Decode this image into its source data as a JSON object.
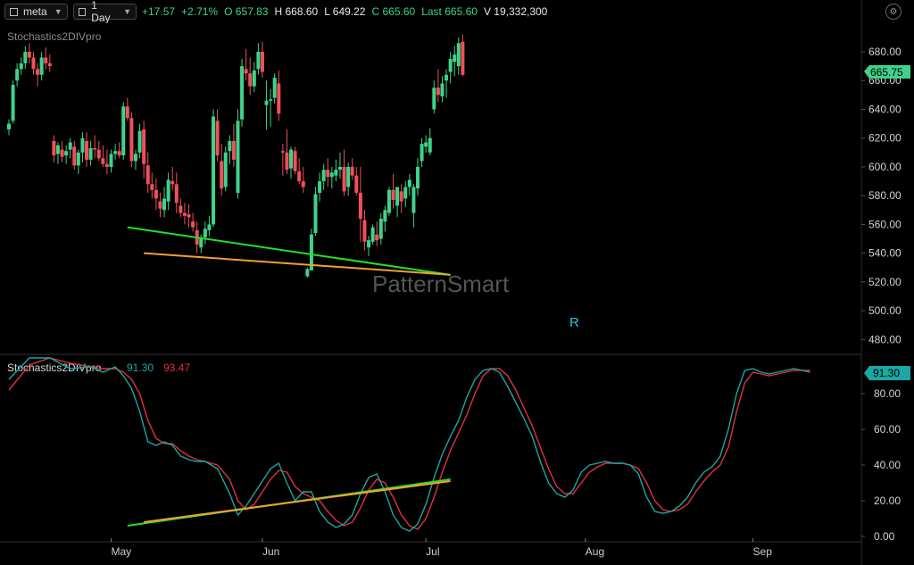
{
  "toolbar": {
    "symbol": "meta",
    "interval": "1 Day",
    "change": "+17.57",
    "change_pct": "+2.71%",
    "open_label": "O",
    "open": "657.83",
    "high_label": "H",
    "high": "668.60",
    "low_label": "L",
    "low": "649.22",
    "close_label": "C",
    "close": "665.60",
    "last_label": "Last",
    "last": "665.60",
    "volume_label": "V",
    "volume": "19,332,300"
  },
  "colors": {
    "up": "#3fd28a",
    "down": "#f0505a",
    "k_line": "#1ba7a4",
    "d_line": "#e0303f",
    "div_green": "#22e02a",
    "div_orange": "#f0a030"
  },
  "chart_data": [
    {
      "type": "candlestick",
      "indicator_name": "Stochastics2DIVpro",
      "watermark": "PatternSmart",
      "annotation": "R",
      "price_badge": "665.75",
      "ylim": [
        470,
        690
      ],
      "yticks": [
        "680.00",
        "660.00",
        "640.00",
        "620.00",
        "600.00",
        "580.00",
        "560.00",
        "540.00",
        "520.00",
        "500.00",
        "480.00"
      ],
      "x_labels": [
        "May",
        "Jun",
        "Jul",
        "Aug",
        "Sep"
      ],
      "candles": [
        [
          626,
          633,
          622,
          630
        ],
        [
          632,
          660,
          630,
          657
        ],
        [
          660,
          672,
          656,
          668
        ],
        [
          668,
          676,
          664,
          672
        ],
        [
          672,
          684,
          668,
          680
        ],
        [
          680,
          686,
          672,
          676
        ],
        [
          676,
          680,
          664,
          668
        ],
        [
          668,
          672,
          656,
          664
        ],
        [
          664,
          680,
          660,
          676
        ],
        [
          676,
          683,
          668,
          672
        ],
        [
          672,
          678,
          666,
          670
        ],
        [
          618,
          622,
          603,
          608
        ],
        [
          609,
          617,
          602,
          615
        ],
        [
          612,
          618,
          603,
          607
        ],
        [
          608,
          615,
          602,
          611
        ],
        [
          612,
          620,
          606,
          617
        ],
        [
          614,
          618,
          598,
          601
        ],
        [
          601,
          612,
          595,
          610
        ],
        [
          610,
          624,
          603,
          620
        ],
        [
          618,
          624,
          600,
          605
        ],
        [
          605,
          618,
          601,
          613
        ],
        [
          613,
          622,
          606,
          612
        ],
        [
          612,
          618,
          604,
          606
        ],
        [
          606,
          615,
          600,
          602
        ],
        [
          602,
          612,
          595,
          600
        ],
        [
          600,
          612,
          596,
          609
        ],
        [
          609,
          616,
          605,
          611
        ],
        [
          611,
          617,
          606,
          608
        ],
        [
          608,
          645,
          605,
          642
        ],
        [
          642,
          648,
          632,
          634
        ],
        [
          634,
          638,
          600,
          604
        ],
        [
          604,
          612,
          598,
          609
        ],
        [
          610,
          630,
          606,
          625
        ],
        [
          626,
          632,
          592,
          602
        ],
        [
          601,
          610,
          582,
          588
        ],
        [
          588,
          596,
          578,
          584
        ],
        [
          584,
          592,
          570,
          578
        ],
        [
          576,
          582,
          565,
          571
        ],
        [
          570,
          586,
          565,
          578
        ],
        [
          576,
          596,
          570,
          591
        ],
        [
          590,
          600,
          584,
          588
        ],
        [
          588,
          596,
          568,
          575
        ],
        [
          573,
          578,
          565,
          568
        ],
        [
          568,
          575,
          560,
          566
        ],
        [
          567,
          574,
          558,
          565
        ],
        [
          562,
          568,
          555,
          558
        ],
        [
          556,
          562,
          540,
          546
        ],
        [
          544,
          553,
          540,
          551
        ],
        [
          551,
          562,
          546,
          557
        ],
        [
          556,
          566,
          552,
          560
        ],
        [
          560,
          640,
          558,
          635
        ],
        [
          632,
          640,
          604,
          608
        ],
        [
          604,
          616,
          580,
          585
        ],
        [
          586,
          614,
          583,
          610
        ],
        [
          611,
          622,
          602,
          618
        ],
        [
          618,
          630,
          600,
          605
        ],
        [
          582,
          640,
          578,
          632
        ],
        [
          633,
          675,
          628,
          670
        ],
        [
          668,
          682,
          660,
          665
        ],
        [
          665,
          676,
          650,
          656
        ],
        [
          656,
          673,
          652,
          667
        ],
        [
          668,
          686,
          664,
          680
        ],
        [
          680,
          687,
          662,
          666
        ],
        [
          643,
          660,
          626,
          646
        ],
        [
          646,
          654,
          628,
          647
        ],
        [
          648,
          665,
          644,
          662
        ],
        [
          658,
          667,
          632,
          637
        ],
        [
          611,
          616,
          594,
          610
        ],
        [
          610,
          626,
          595,
          598
        ],
        [
          599,
          614,
          592,
          612
        ],
        [
          611,
          614,
          595,
          597
        ],
        [
          597,
          606,
          588,
          590
        ],
        [
          590,
          600,
          582,
          586
        ],
        [
          524,
          530,
          523,
          529
        ],
        [
          528,
          557,
          528,
          553
        ],
        [
          554,
          586,
          552,
          581
        ],
        [
          582,
          596,
          576,
          590
        ],
        [
          590,
          602,
          584,
          598
        ],
        [
          598,
          606,
          586,
          593
        ],
        [
          593,
          600,
          585,
          596
        ],
        [
          594,
          605,
          590,
          598
        ],
        [
          598,
          610,
          592,
          600
        ],
        [
          600,
          612,
          580,
          583
        ],
        [
          586,
          603,
          580,
          600
        ],
        [
          600,
          606,
          591,
          594
        ],
        [
          594,
          600,
          580,
          582
        ],
        [
          582,
          600,
          548,
          564
        ],
        [
          563,
          570,
          542,
          548
        ],
        [
          544,
          552,
          538,
          549
        ],
        [
          548,
          560,
          546,
          558
        ],
        [
          553,
          562,
          545,
          549
        ],
        [
          550,
          568,
          546,
          564
        ],
        [
          562,
          573,
          555,
          570
        ],
        [
          568,
          586,
          566,
          584
        ],
        [
          584,
          595,
          571,
          577
        ],
        [
          573,
          586,
          565,
          586
        ],
        [
          583,
          588,
          568,
          576
        ],
        [
          578,
          590,
          572,
          586
        ],
        [
          586,
          595,
          580,
          591
        ],
        [
          568,
          588,
          558,
          586
        ],
        [
          585,
          606,
          580,
          600
        ],
        [
          604,
          620,
          600,
          616
        ],
        [
          614,
          622,
          610,
          617
        ],
        [
          610,
          627,
          608,
          620
        ],
        [
          640,
          660,
          637,
          655
        ],
        [
          655,
          668,
          645,
          650
        ],
        [
          649,
          663,
          645,
          658
        ],
        [
          660,
          668,
          648,
          664
        ],
        [
          666,
          680,
          658,
          675
        ],
        [
          673,
          684,
          663,
          678
        ],
        [
          670,
          690,
          664,
          686
        ],
        [
          687,
          692,
          663,
          664
        ]
      ],
      "price_divergence": {
        "green": [
          [
            29,
            558
          ],
          [
            108,
            525
          ]
        ],
        "orange": [
          [
            33,
            540
          ],
          [
            108,
            525
          ]
        ]
      }
    },
    {
      "type": "line",
      "name": "Stochastics2DIVpro",
      "k_value": "91.30",
      "d_value": "93.47",
      "price_badge": "91.30",
      "ylim": [
        0,
        100
      ],
      "yticks": [
        "80.00",
        "60.00",
        "40.00",
        "20.00",
        "0.00"
      ],
      "k_points": [
        [
          0,
          88
        ],
        [
          5,
          100
        ],
        [
          10,
          100
        ],
        [
          15,
          94
        ],
        [
          20,
          95
        ],
        [
          23,
          92
        ],
        [
          26,
          95
        ],
        [
          28,
          90
        ],
        [
          30,
          83
        ],
        [
          32,
          70
        ],
        [
          34,
          53
        ],
        [
          36,
          51
        ],
        [
          38,
          53
        ],
        [
          40,
          51
        ],
        [
          42,
          45
        ],
        [
          44,
          43
        ],
        [
          46,
          42
        ],
        [
          48,
          42
        ],
        [
          51,
          38
        ],
        [
          54,
          24
        ],
        [
          56,
          12
        ],
        [
          58,
          17
        ],
        [
          60,
          24
        ],
        [
          62,
          31
        ],
        [
          64,
          38
        ],
        [
          66,
          41
        ],
        [
          68,
          30
        ],
        [
          70,
          20
        ],
        [
          72,
          25
        ],
        [
          74,
          25
        ],
        [
          76,
          14
        ],
        [
          78,
          8
        ],
        [
          80,
          5
        ],
        [
          82,
          7
        ],
        [
          84,
          12
        ],
        [
          86,
          24
        ],
        [
          88,
          33
        ],
        [
          90,
          35
        ],
        [
          92,
          25
        ],
        [
          94,
          12
        ],
        [
          96,
          5
        ],
        [
          98,
          3
        ],
        [
          100,
          7
        ],
        [
          102,
          18
        ],
        [
          104,
          33
        ],
        [
          106,
          46
        ],
        [
          108,
          56
        ],
        [
          110,
          65
        ],
        [
          112,
          78
        ],
        [
          114,
          88
        ],
        [
          116,
          93
        ],
        [
          118,
          94
        ],
        [
          120,
          92
        ],
        [
          122,
          84
        ],
        [
          124,
          75
        ],
        [
          126,
          66
        ],
        [
          128,
          56
        ],
        [
          130,
          42
        ],
        [
          132,
          30
        ],
        [
          134,
          24
        ],
        [
          136,
          22
        ],
        [
          138,
          26
        ],
        [
          140,
          36
        ],
        [
          142,
          40
        ],
        [
          144,
          41
        ],
        [
          146,
          42
        ],
        [
          148,
          41
        ],
        [
          150,
          41
        ],
        [
          152,
          40
        ],
        [
          154,
          35
        ],
        [
          156,
          22
        ],
        [
          158,
          14
        ],
        [
          160,
          13
        ],
        [
          162,
          14
        ],
        [
          164,
          17
        ],
        [
          166,
          22
        ],
        [
          168,
          30
        ],
        [
          170,
          36
        ],
        [
          172,
          39
        ],
        [
          174,
          45
        ],
        [
          176,
          60
        ],
        [
          178,
          80
        ],
        [
          180,
          93
        ],
        [
          182,
          94
        ],
        [
          184,
          92
        ],
        [
          186,
          91
        ],
        [
          188,
          92
        ],
        [
          190,
          93
        ],
        [
          192,
          94
        ],
        [
          194,
          93
        ],
        [
          196,
          92
        ]
      ],
      "d_points": [
        [
          0,
          82
        ],
        [
          5,
          96
        ],
        [
          10,
          100
        ],
        [
          15,
          97
        ],
        [
          20,
          95
        ],
        [
          23,
          94
        ],
        [
          26,
          94
        ],
        [
          28,
          92
        ],
        [
          30,
          88
        ],
        [
          32,
          80
        ],
        [
          34,
          65
        ],
        [
          36,
          55
        ],
        [
          38,
          52
        ],
        [
          40,
          52
        ],
        [
          42,
          48
        ],
        [
          44,
          45
        ],
        [
          46,
          43
        ],
        [
          48,
          42
        ],
        [
          51,
          40
        ],
        [
          54,
          32
        ],
        [
          56,
          20
        ],
        [
          58,
          15
        ],
        [
          60,
          18
        ],
        [
          62,
          25
        ],
        [
          64,
          32
        ],
        [
          66,
          37
        ],
        [
          68,
          36
        ],
        [
          70,
          28
        ],
        [
          72,
          24
        ],
        [
          74,
          22
        ],
        [
          76,
          20
        ],
        [
          78,
          14
        ],
        [
          80,
          9
        ],
        [
          82,
          6
        ],
        [
          84,
          8
        ],
        [
          86,
          16
        ],
        [
          88,
          26
        ],
        [
          90,
          32
        ],
        [
          92,
          30
        ],
        [
          94,
          22
        ],
        [
          96,
          12
        ],
        [
          98,
          6
        ],
        [
          100,
          4
        ],
        [
          102,
          10
        ],
        [
          104,
          22
        ],
        [
          106,
          36
        ],
        [
          108,
          48
        ],
        [
          110,
          58
        ],
        [
          112,
          68
        ],
        [
          114,
          80
        ],
        [
          116,
          90
        ],
        [
          118,
          94
        ],
        [
          120,
          94
        ],
        [
          122,
          90
        ],
        [
          124,
          82
        ],
        [
          126,
          72
        ],
        [
          128,
          62
        ],
        [
          130,
          50
        ],
        [
          132,
          38
        ],
        [
          134,
          28
        ],
        [
          136,
          24
        ],
        [
          138,
          24
        ],
        [
          140,
          30
        ],
        [
          142,
          36
        ],
        [
          144,
          39
        ],
        [
          146,
          41
        ],
        [
          148,
          41
        ],
        [
          150,
          41
        ],
        [
          152,
          40
        ],
        [
          154,
          38
        ],
        [
          156,
          30
        ],
        [
          158,
          20
        ],
        [
          160,
          15
        ],
        [
          162,
          14
        ],
        [
          164,
          15
        ],
        [
          166,
          18
        ],
        [
          168,
          25
        ],
        [
          170,
          31
        ],
        [
          172,
          36
        ],
        [
          174,
          40
        ],
        [
          176,
          50
        ],
        [
          178,
          70
        ],
        [
          180,
          86
        ],
        [
          182,
          92
        ],
        [
          184,
          91
        ],
        [
          186,
          90
        ],
        [
          188,
          91
        ],
        [
          190,
          92
        ],
        [
          192,
          93
        ],
        [
          194,
          93
        ],
        [
          196,
          93
        ]
      ],
      "ind_divergence": {
        "green": [
          [
            29,
            6
          ],
          [
            108,
            32
          ]
        ],
        "orange": [
          [
            33,
            8
          ],
          [
            108,
            31
          ]
        ]
      }
    }
  ]
}
